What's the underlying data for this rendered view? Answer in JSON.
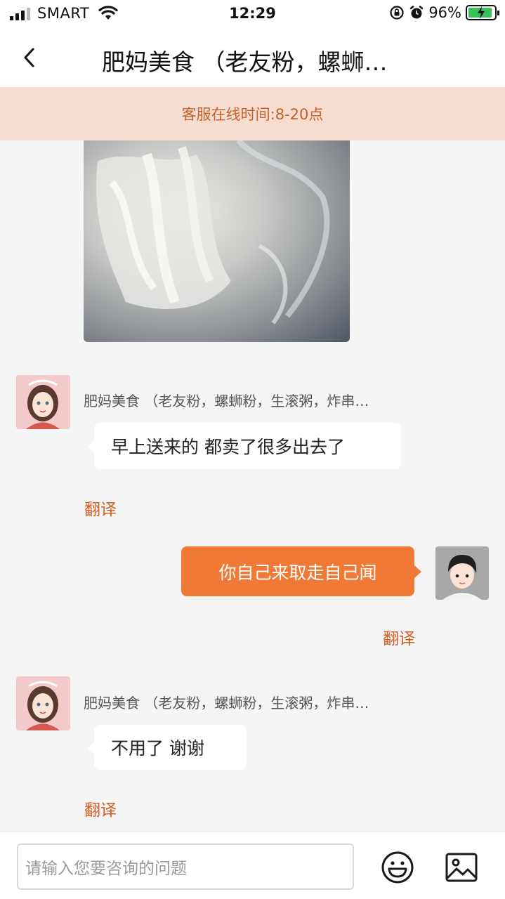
{
  "status_bar": {
    "carrier": "SMART",
    "time": "12:29",
    "battery": "96%"
  },
  "nav": {
    "title": "肥妈美食 （老友粉，螺蛳…"
  },
  "banner": {
    "text": "客服在线时间:8-20点"
  },
  "messages": [
    {
      "sender": "肥妈美食 （老友粉，螺蛳粉，生滚粥，炸串…",
      "text": "早上送来的 都卖了很多出去了",
      "translate": "翻译"
    },
    {
      "text": "你自己来取走自己闻",
      "translate": "翻译"
    },
    {
      "sender": "肥妈美食 （老友粉，螺蛳粉，生滚粥，炸串…",
      "text": "不用了 谢谢",
      "translate": "翻译"
    }
  ],
  "input": {
    "placeholder": "请输入您要咨询的问题"
  },
  "colors": {
    "accent": "#f07a35",
    "banner_bg": "#f7ddd0",
    "banner_text": "#c0622e",
    "translate": "#d35e26"
  },
  "icons": [
    "back-icon",
    "wifi-icon",
    "alarm-icon",
    "lock-rotation-icon",
    "emoji-icon",
    "image-icon"
  ]
}
